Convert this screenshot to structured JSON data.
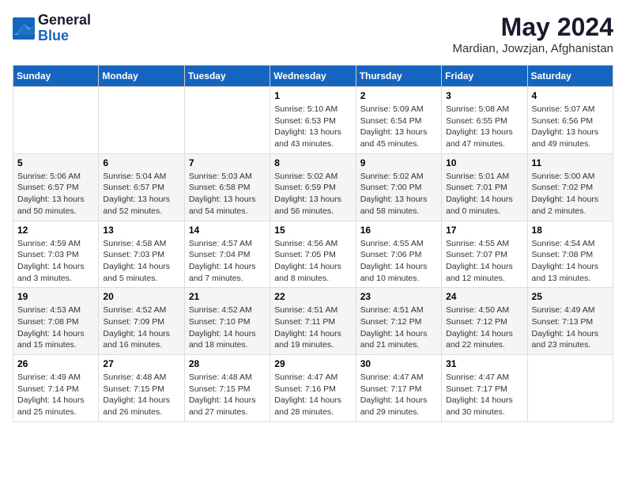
{
  "header": {
    "logo_general": "General",
    "logo_blue": "Blue",
    "month_year": "May 2024",
    "location": "Mardian, Jowzjan, Afghanistan"
  },
  "weekdays": [
    "Sunday",
    "Monday",
    "Tuesday",
    "Wednesday",
    "Thursday",
    "Friday",
    "Saturday"
  ],
  "weeks": [
    [
      {
        "day": "",
        "sunrise": "",
        "sunset": "",
        "daylight": ""
      },
      {
        "day": "",
        "sunrise": "",
        "sunset": "",
        "daylight": ""
      },
      {
        "day": "",
        "sunrise": "",
        "sunset": "",
        "daylight": ""
      },
      {
        "day": "1",
        "sunrise": "Sunrise: 5:10 AM",
        "sunset": "Sunset: 6:53 PM",
        "daylight": "Daylight: 13 hours and 43 minutes."
      },
      {
        "day": "2",
        "sunrise": "Sunrise: 5:09 AM",
        "sunset": "Sunset: 6:54 PM",
        "daylight": "Daylight: 13 hours and 45 minutes."
      },
      {
        "day": "3",
        "sunrise": "Sunrise: 5:08 AM",
        "sunset": "Sunset: 6:55 PM",
        "daylight": "Daylight: 13 hours and 47 minutes."
      },
      {
        "day": "4",
        "sunrise": "Sunrise: 5:07 AM",
        "sunset": "Sunset: 6:56 PM",
        "daylight": "Daylight: 13 hours and 49 minutes."
      }
    ],
    [
      {
        "day": "5",
        "sunrise": "Sunrise: 5:06 AM",
        "sunset": "Sunset: 6:57 PM",
        "daylight": "Daylight: 13 hours and 50 minutes."
      },
      {
        "day": "6",
        "sunrise": "Sunrise: 5:04 AM",
        "sunset": "Sunset: 6:57 PM",
        "daylight": "Daylight: 13 hours and 52 minutes."
      },
      {
        "day": "7",
        "sunrise": "Sunrise: 5:03 AM",
        "sunset": "Sunset: 6:58 PM",
        "daylight": "Daylight: 13 hours and 54 minutes."
      },
      {
        "day": "8",
        "sunrise": "Sunrise: 5:02 AM",
        "sunset": "Sunset: 6:59 PM",
        "daylight": "Daylight: 13 hours and 56 minutes."
      },
      {
        "day": "9",
        "sunrise": "Sunrise: 5:02 AM",
        "sunset": "Sunset: 7:00 PM",
        "daylight": "Daylight: 13 hours and 58 minutes."
      },
      {
        "day": "10",
        "sunrise": "Sunrise: 5:01 AM",
        "sunset": "Sunset: 7:01 PM",
        "daylight": "Daylight: 14 hours and 0 minutes."
      },
      {
        "day": "11",
        "sunrise": "Sunrise: 5:00 AM",
        "sunset": "Sunset: 7:02 PM",
        "daylight": "Daylight: 14 hours and 2 minutes."
      }
    ],
    [
      {
        "day": "12",
        "sunrise": "Sunrise: 4:59 AM",
        "sunset": "Sunset: 7:03 PM",
        "daylight": "Daylight: 14 hours and 3 minutes."
      },
      {
        "day": "13",
        "sunrise": "Sunrise: 4:58 AM",
        "sunset": "Sunset: 7:03 PM",
        "daylight": "Daylight: 14 hours and 5 minutes."
      },
      {
        "day": "14",
        "sunrise": "Sunrise: 4:57 AM",
        "sunset": "Sunset: 7:04 PM",
        "daylight": "Daylight: 14 hours and 7 minutes."
      },
      {
        "day": "15",
        "sunrise": "Sunrise: 4:56 AM",
        "sunset": "Sunset: 7:05 PM",
        "daylight": "Daylight: 14 hours and 8 minutes."
      },
      {
        "day": "16",
        "sunrise": "Sunrise: 4:55 AM",
        "sunset": "Sunset: 7:06 PM",
        "daylight": "Daylight: 14 hours and 10 minutes."
      },
      {
        "day": "17",
        "sunrise": "Sunrise: 4:55 AM",
        "sunset": "Sunset: 7:07 PM",
        "daylight": "Daylight: 14 hours and 12 minutes."
      },
      {
        "day": "18",
        "sunrise": "Sunrise: 4:54 AM",
        "sunset": "Sunset: 7:08 PM",
        "daylight": "Daylight: 14 hours and 13 minutes."
      }
    ],
    [
      {
        "day": "19",
        "sunrise": "Sunrise: 4:53 AM",
        "sunset": "Sunset: 7:08 PM",
        "daylight": "Daylight: 14 hours and 15 minutes."
      },
      {
        "day": "20",
        "sunrise": "Sunrise: 4:52 AM",
        "sunset": "Sunset: 7:09 PM",
        "daylight": "Daylight: 14 hours and 16 minutes."
      },
      {
        "day": "21",
        "sunrise": "Sunrise: 4:52 AM",
        "sunset": "Sunset: 7:10 PM",
        "daylight": "Daylight: 14 hours and 18 minutes."
      },
      {
        "day": "22",
        "sunrise": "Sunrise: 4:51 AM",
        "sunset": "Sunset: 7:11 PM",
        "daylight": "Daylight: 14 hours and 19 minutes."
      },
      {
        "day": "23",
        "sunrise": "Sunrise: 4:51 AM",
        "sunset": "Sunset: 7:12 PM",
        "daylight": "Daylight: 14 hours and 21 minutes."
      },
      {
        "day": "24",
        "sunrise": "Sunrise: 4:50 AM",
        "sunset": "Sunset: 7:12 PM",
        "daylight": "Daylight: 14 hours and 22 minutes."
      },
      {
        "day": "25",
        "sunrise": "Sunrise: 4:49 AM",
        "sunset": "Sunset: 7:13 PM",
        "daylight": "Daylight: 14 hours and 23 minutes."
      }
    ],
    [
      {
        "day": "26",
        "sunrise": "Sunrise: 4:49 AM",
        "sunset": "Sunset: 7:14 PM",
        "daylight": "Daylight: 14 hours and 25 minutes."
      },
      {
        "day": "27",
        "sunrise": "Sunrise: 4:48 AM",
        "sunset": "Sunset: 7:15 PM",
        "daylight": "Daylight: 14 hours and 26 minutes."
      },
      {
        "day": "28",
        "sunrise": "Sunrise: 4:48 AM",
        "sunset": "Sunset: 7:15 PM",
        "daylight": "Daylight: 14 hours and 27 minutes."
      },
      {
        "day": "29",
        "sunrise": "Sunrise: 4:47 AM",
        "sunset": "Sunset: 7:16 PM",
        "daylight": "Daylight: 14 hours and 28 minutes."
      },
      {
        "day": "30",
        "sunrise": "Sunrise: 4:47 AM",
        "sunset": "Sunset: 7:17 PM",
        "daylight": "Daylight: 14 hours and 29 minutes."
      },
      {
        "day": "31",
        "sunrise": "Sunrise: 4:47 AM",
        "sunset": "Sunset: 7:17 PM",
        "daylight": "Daylight: 14 hours and 30 minutes."
      },
      {
        "day": "",
        "sunrise": "",
        "sunset": "",
        "daylight": ""
      }
    ]
  ]
}
